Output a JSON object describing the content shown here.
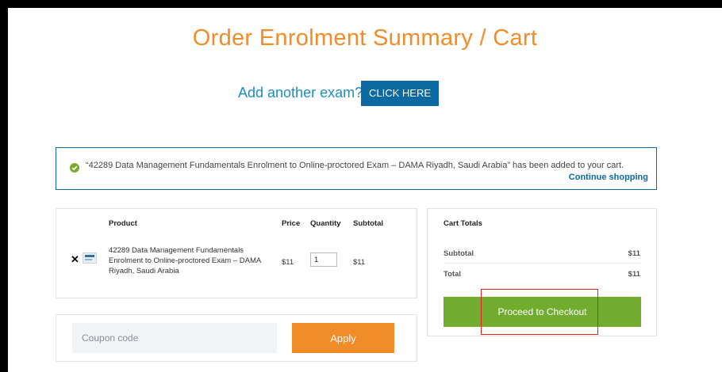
{
  "page": {
    "title": "Order Enrolment Summary / Cart",
    "add_another": {
      "text": "Add another exam?",
      "button_label": "CLICK HERE"
    }
  },
  "notice": {
    "icon": "check-circle-icon",
    "message": "“42289 Data Management Fundamentals Enrolment to Online-proctored Exam – DAMA Riyadh, Saudi Arabia” has been added to your cart.",
    "continue_label": "Continue shopping"
  },
  "cart": {
    "headers": {
      "product": "Product",
      "price": "Price",
      "quantity": "Quantity",
      "subtotal": "Subtotal"
    },
    "items": [
      {
        "remove_icon": "close-icon",
        "name": "42289 Data Management Fundamentals Enrolment to Online-proctored Exam – DAMA Riyadh, Saudi Arabia",
        "price": "$11",
        "quantity": "1",
        "subtotal": "$11"
      }
    ]
  },
  "coupon": {
    "placeholder": "Coupon code",
    "apply_label": "Apply"
  },
  "totals": {
    "title": "Cart Totals",
    "subtotal_label": "Subtotal",
    "subtotal_value": "$11",
    "total_label": "Total",
    "total_value": "$11",
    "checkout_label": "Proceed to Checkout"
  },
  "colors": {
    "accent_orange": "#f28c28",
    "link_blue": "#1a8fc0",
    "button_blue": "#0a6aa1",
    "checkout_green": "#72ac2f",
    "highlight_red": "#e8231f"
  }
}
